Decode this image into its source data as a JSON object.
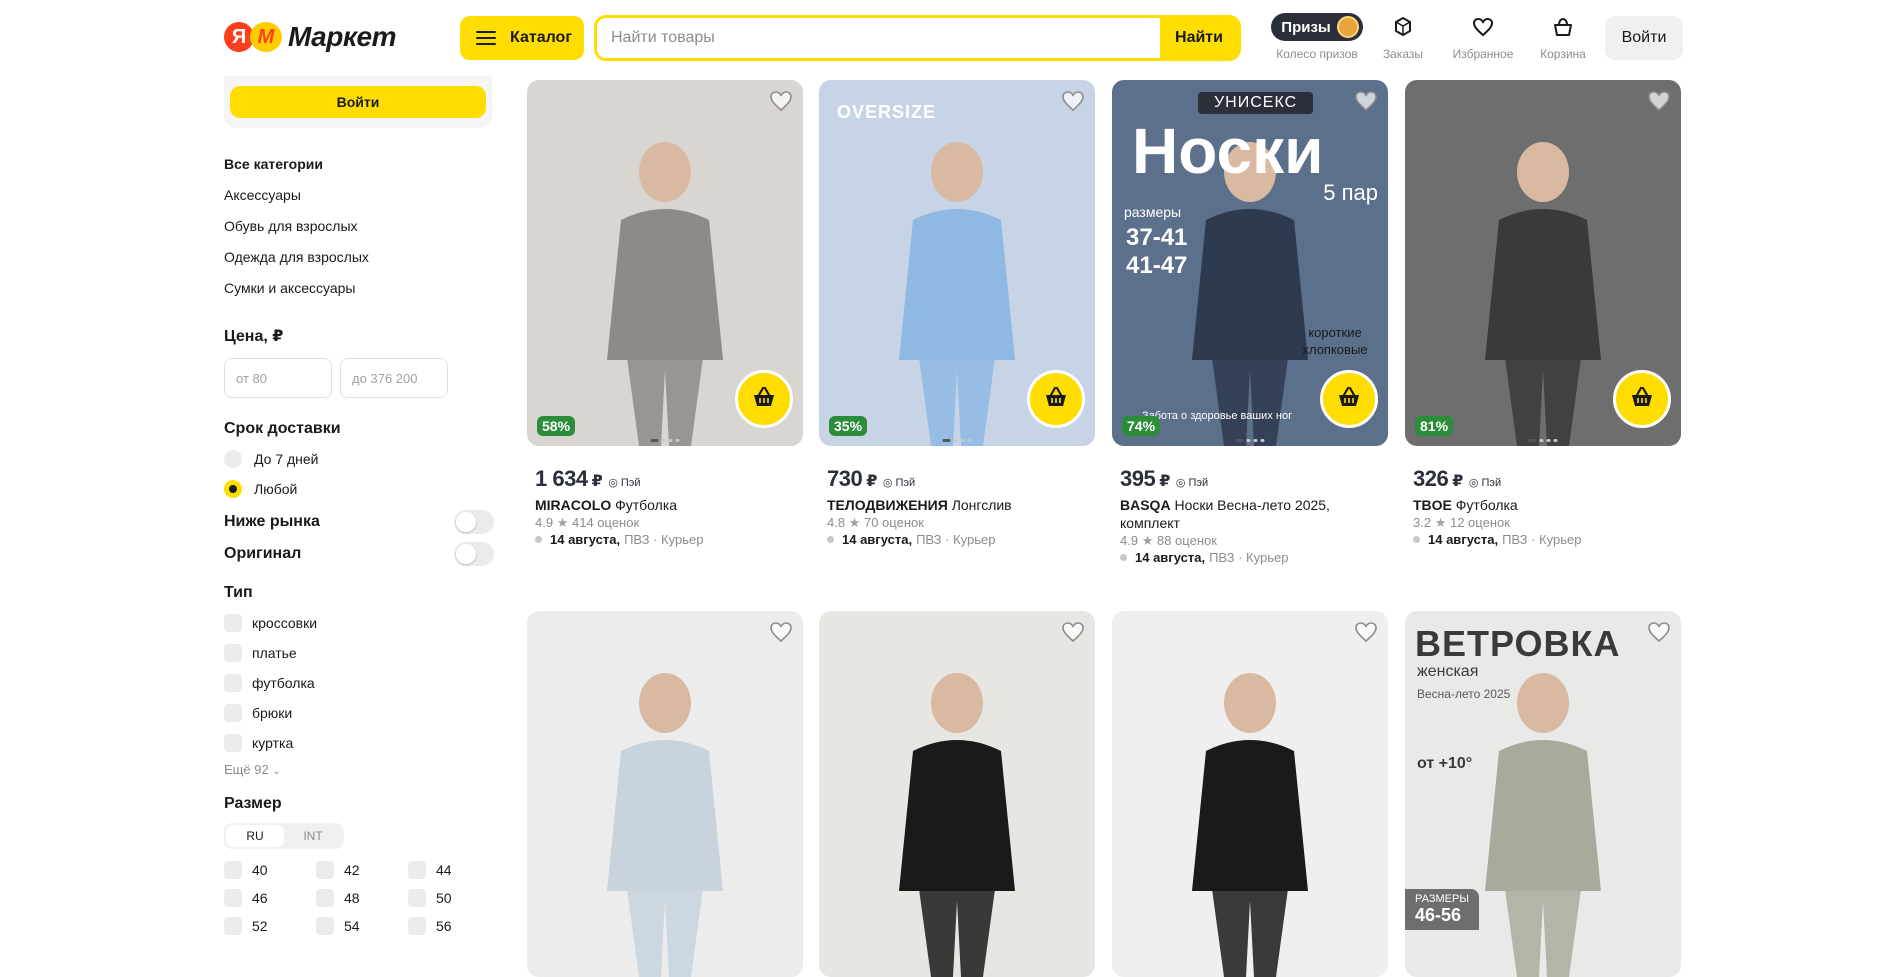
{
  "header": {
    "logo_ya": "Я",
    "logo_m": "M",
    "logo_text": "Маркет",
    "catalog_label": "Каталог",
    "search_placeholder": "Найти товары",
    "search_button": "Найти",
    "prizes_label": "Призы",
    "nav": [
      {
        "label": "Колесо призов",
        "icon": "prize-wheel-icon"
      },
      {
        "label": "Заказы",
        "icon": "box-icon"
      },
      {
        "label": "Избранное",
        "icon": "heart-icon"
      },
      {
        "label": "Корзина",
        "icon": "cart-icon"
      }
    ],
    "login": "Войти"
  },
  "sidebar": {
    "login": "Войти",
    "categories_head": "Все категории",
    "categories": [
      "Аксессуары",
      "Обувь для взрослых",
      "Одежда для взрослых",
      "Сумки и аксессуары"
    ],
    "price_title": "Цена, ₽",
    "price_from": "от 80",
    "price_to": "до 376 200",
    "delivery_title": "Срок доставки",
    "delivery_options": [
      "До 7 дней",
      "Любой"
    ],
    "delivery_selected": "Любой",
    "below_market": "Ниже рынка",
    "original": "Оригинал",
    "type_title": "Тип",
    "types": [
      "кроссовки",
      "платье",
      "футболка",
      "брюки",
      "куртка"
    ],
    "more": "Ещё 92",
    "size_title": "Размер",
    "size_tabs": [
      "RU",
      "INT"
    ],
    "sizes": [
      "40",
      "42",
      "44",
      "46",
      "48",
      "50",
      "52",
      "54",
      "56"
    ]
  },
  "products": [
    {
      "discount": "58%",
      "price": "1 634",
      "currency": "₽",
      "pay": "Пэй",
      "brand": "MIRACOLO",
      "name": "Футболка",
      "rating": "4.9",
      "reviews": "414 оценок",
      "date": "14 августа,",
      "delivery": "ПВЗ · Курьер",
      "image_colors": [
        "#d9d6d1",
        "#8e8a86"
      ]
    },
    {
      "discount": "35%",
      "price": "730",
      "currency": "₽",
      "pay": "Пэй",
      "brand": "ТЕЛОДВИЖЕНИЯ",
      "name": "Лонгслив",
      "rating": "4.8",
      "reviews": "70 оценок",
      "date": "14 августа,",
      "delivery": "ПВЗ · Курьер",
      "image_colors": [
        "#c7d4e6",
        "#8fb8e3"
      ],
      "overlay": "OVERSIZE"
    },
    {
      "discount": "74%",
      "price": "395",
      "currency": "₽",
      "pay": "Пэй",
      "brand": "BASQA",
      "name": "Носки Весна-лето 2025, комплект",
      "rating": "4.9",
      "reviews": "88 оценок",
      "date": "14 августа,",
      "delivery": "ПВЗ · Курьер",
      "image_colors": [
        "#5c6f8b",
        "#2e3a4f"
      ],
      "overlay_badge": "УНИСЕКС",
      "overlay_title": "Носки",
      "overlay_sub": "5 пар",
      "overlay_sizes": "37-41 41-47",
      "overlay_sizes_label": "размеры",
      "overlay_note": "короткие хлопковые",
      "overlay_footer": "Забота о здоровье ваших ног"
    },
    {
      "discount": "81%",
      "price": "326",
      "currency": "₽",
      "pay": "Пэй",
      "brand": "TBOE",
      "name": "Футболка",
      "rating": "3.2",
      "reviews": "12 оценок",
      "date": "14 августа,",
      "delivery": "ПВЗ · Курьер",
      "image_colors": [
        "#6e6e6e",
        "#3a3a3a"
      ]
    },
    {
      "image_colors": [
        "#ececec",
        "#c8d3de"
      ],
      "discount": ""
    },
    {
      "image_colors": [
        "#e8e6e3",
        "#1a1a1a"
      ],
      "discount": ""
    },
    {
      "image_colors": [
        "#efefef",
        "#1a1a1a"
      ],
      "discount": ""
    },
    {
      "image_colors": [
        "#e9e9e7",
        "#a8ab9c"
      ],
      "overlay_title": "ВЕТРОВКА",
      "overlay_sub": "женская",
      "overlay_season": "Весна-лето 2025",
      "overlay_temp": "от +10°",
      "overlay_sizes_label": "РАЗМЕРЫ",
      "overlay_sizes": "46-56",
      "discount": ""
    }
  ]
}
